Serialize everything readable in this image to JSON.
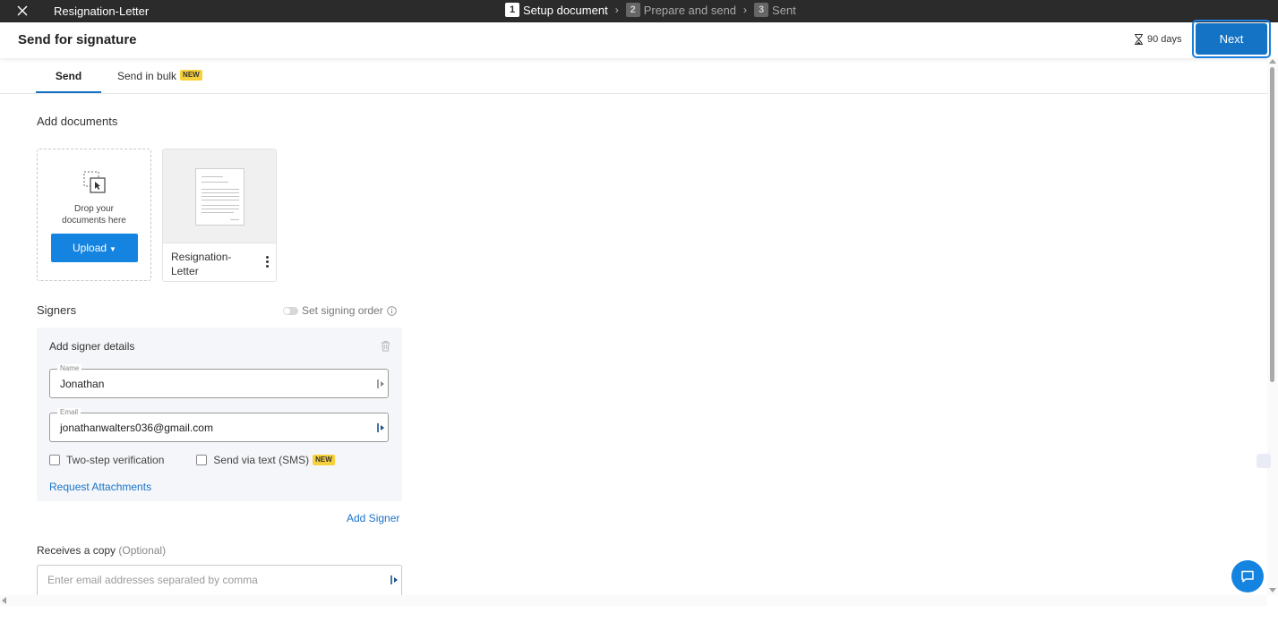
{
  "topbar": {
    "doc_title": "Resignation-Letter",
    "steps": [
      {
        "num": "1",
        "label": "Setup document"
      },
      {
        "num": "2",
        "label": "Prepare and send"
      },
      {
        "num": "3",
        "label": "Sent"
      }
    ],
    "step_separator": "›"
  },
  "header": {
    "title": "Send for signature",
    "expiry": "90 days",
    "next_label": "Next"
  },
  "tabs": {
    "send": "Send",
    "bulk": "Send in bulk",
    "bulk_badge": "NEW"
  },
  "documents": {
    "section_title": "Add documents",
    "drop_text": "Drop your documents here",
    "upload_label": "Upload",
    "files": [
      {
        "name": "Resignation-Letter"
      }
    ]
  },
  "signers": {
    "section_title": "Signers",
    "signing_order_label": "Set signing order",
    "signing_order_enabled": false,
    "box_title": "Add signer details",
    "name_label": "Name",
    "name_value": "Jonathan",
    "email_label": "Email",
    "email_value": "jonathanwalters036@gmail.com",
    "two_step_label": "Two-step verification",
    "sms_label": "Send via text (SMS)",
    "sms_badge": "NEW",
    "request_attachments": "Request Attachments",
    "add_signer": "Add Signer"
  },
  "copy": {
    "title": "Receives a copy",
    "optional": "(Optional)",
    "placeholder": "Enter email addresses separated by comma"
  },
  "colors": {
    "primary": "#1473c4",
    "link": "#1a73c9",
    "badge": "#f7d13b",
    "topbar": "#2b2b2b"
  }
}
